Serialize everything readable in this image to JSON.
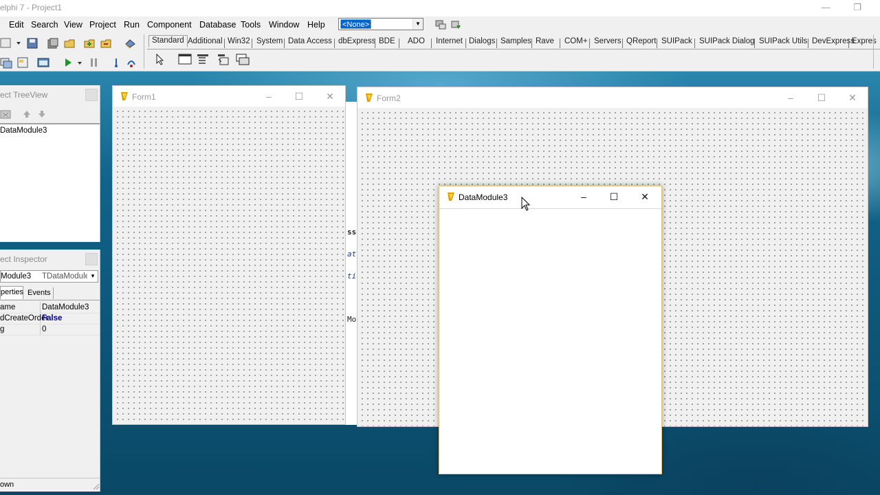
{
  "ide": {
    "title": "elphi 7 - Project1",
    "menu": [
      "Edit",
      "Search",
      "View",
      "Project",
      "Run",
      "Component",
      "Database",
      "Tools",
      "Window",
      "Help"
    ],
    "config_combo": "<None>",
    "palette_tabs": [
      "Standard",
      "Additional",
      "Win32",
      "System",
      "Data Access",
      "dbExpress",
      "BDE",
      "ADO",
      "Internet",
      "Dialogs",
      "Samples",
      "Rave",
      "COM+",
      "Servers",
      "QReport",
      "SUIPack",
      "SUIPack Dialog",
      "SUIPack Utils",
      "DevExpress",
      "Expres"
    ]
  },
  "tree_view": {
    "title": "ect TreeView",
    "items": [
      "DataModule3"
    ]
  },
  "object_inspector": {
    "title": "ect Inspector",
    "object_name": "Module3",
    "object_type": "TDataModule",
    "tabs": [
      "perties",
      "Events"
    ],
    "rows": [
      {
        "key": "ame",
        "value": "DataModule3"
      },
      {
        "key": "dCreateOrder",
        "value": "False"
      },
      {
        "key": "g",
        "value": "0"
      }
    ],
    "status": "own"
  },
  "editor": {
    "fragments": [
      "ss",
      "at",
      "ti",
      "Mo"
    ]
  },
  "form1": {
    "caption": "Form1"
  },
  "form2": {
    "caption": "Form2"
  },
  "datamodule": {
    "caption": "DataModule3"
  },
  "colors": {
    "accent_selection": "#0a64c8",
    "datamodule_border": "#e5c07a",
    "inspector_bool": "#000080"
  }
}
